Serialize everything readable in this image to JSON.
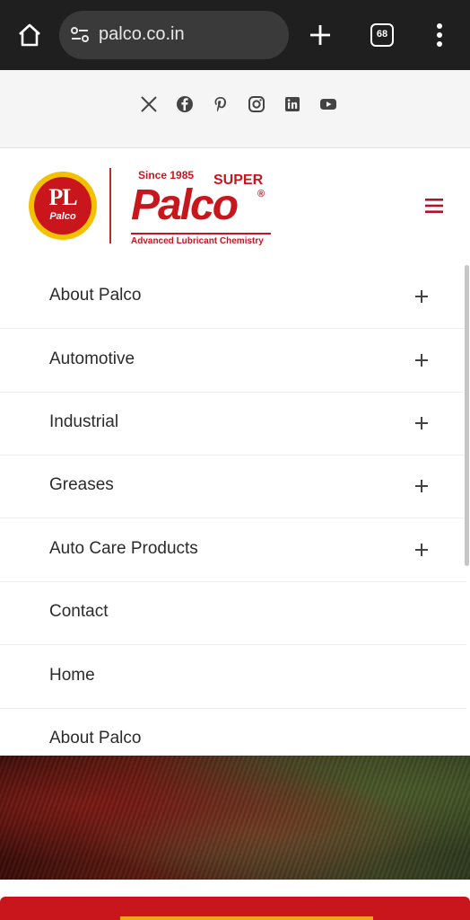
{
  "browser": {
    "url": "palco.co.in",
    "tab_count": "68",
    "icons": [
      "home-icon",
      "site-settings-icon",
      "new-tab-icon",
      "tab-switcher-icon",
      "more-options-icon"
    ]
  },
  "social": {
    "icons": [
      "x-icon",
      "facebook-icon",
      "pinterest-icon",
      "instagram-icon",
      "linkedin-icon",
      "youtube-icon"
    ]
  },
  "logo": {
    "circle_top": "PL",
    "circle_bottom": "Palco",
    "since": "Since 1985",
    "super": "SUPER",
    "brand": "Palco",
    "registered": "®",
    "tagline": "Advanced Lubricant Chemistry"
  },
  "menu": {
    "items": [
      {
        "label": "About Palco",
        "expandable": true
      },
      {
        "label": "Automotive",
        "expandable": true
      },
      {
        "label": "Industrial",
        "expandable": true
      },
      {
        "label": "Greases",
        "expandable": true
      },
      {
        "label": "Auto Care Products",
        "expandable": true
      },
      {
        "label": "Contact",
        "expandable": false
      },
      {
        "label": "Home",
        "expandable": false
      },
      {
        "label": "About Palco",
        "expandable": false
      }
    ]
  },
  "colors": {
    "brand_red": "#c9161d",
    "brand_yellow": "#f2c200",
    "browser_bg": "#1f1f1f",
    "accent_orange": "#f2a31c"
  }
}
